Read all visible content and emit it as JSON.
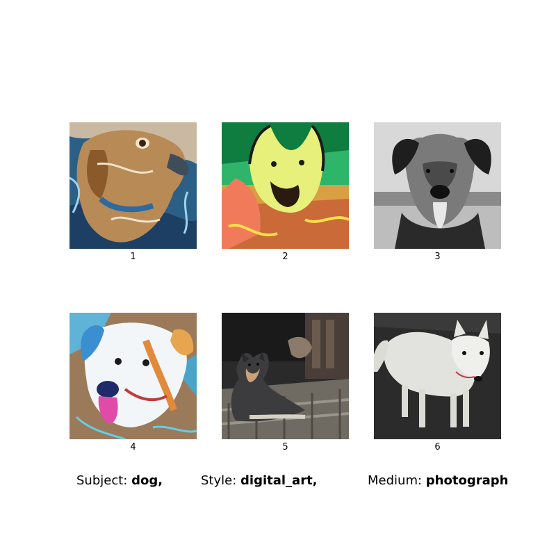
{
  "images": [
    {
      "label": "1",
      "description_icon": "dog-image"
    },
    {
      "label": "2",
      "description_icon": "dog-image"
    },
    {
      "label": "3",
      "description_icon": "dog-image"
    },
    {
      "label": "4",
      "description_icon": "dog-image"
    },
    {
      "label": "5",
      "description_icon": "dog-image"
    },
    {
      "label": "6",
      "description_icon": "dog-image"
    }
  ],
  "captions": {
    "subject_label": "Subject:",
    "subject_value": "dog,",
    "style_label": "Style:",
    "style_value": "digital_art,",
    "medium_label": "Medium:",
    "medium_value": "photograph"
  }
}
